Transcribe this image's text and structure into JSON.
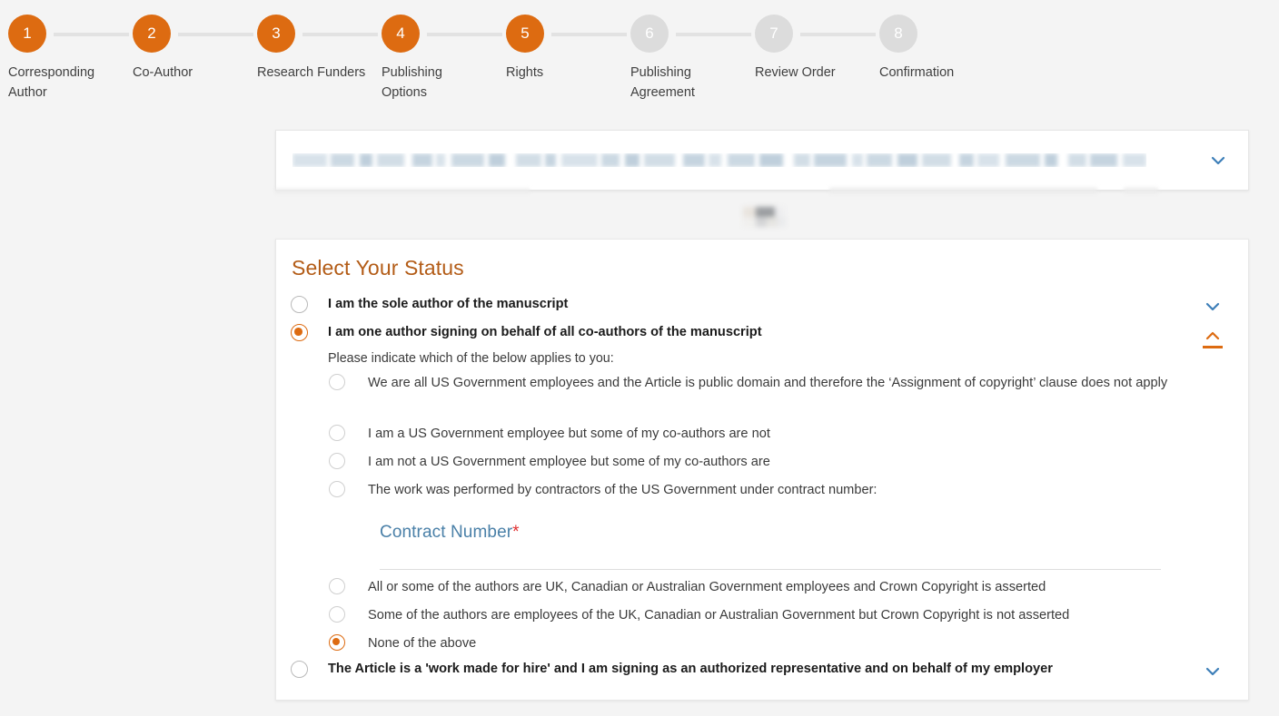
{
  "theme": {
    "accent_orange": "#DD6B11",
    "inactive_gray": "#dcdcdc",
    "link_blue": "#3D7FB8",
    "label_blue": "#4a80a8",
    "required_red": "#e03030",
    "title_orange": "#b35c17",
    "page_bg": "#f4f4f4"
  },
  "stepper": {
    "steps": [
      {
        "number": "1",
        "label": "Corresponding Author",
        "state": "active"
      },
      {
        "number": "2",
        "label": "Co-Author",
        "state": "active"
      },
      {
        "number": "3",
        "label": "Research Funders",
        "state": "active"
      },
      {
        "number": "4",
        "label": "Publishing Options",
        "state": "active"
      },
      {
        "number": "5",
        "label": "Rights",
        "state": "active"
      },
      {
        "number": "6",
        "label": "Publishing Agreement",
        "state": "inactive"
      },
      {
        "number": "7",
        "label": "Review Order",
        "state": "inactive"
      },
      {
        "number": "8",
        "label": "Confirmation",
        "state": "inactive"
      }
    ]
  },
  "redacted_panel": {
    "content": "",
    "expand_icon": "chevron-down-icon"
  },
  "card": {
    "title": "Select Your Status",
    "options": [
      {
        "id": "sole-author",
        "label": "I am the sole author of the manuscript",
        "checked": false,
        "expand_icon": "chevron-down-icon"
      },
      {
        "id": "signing-on-behalf",
        "label": "I am one author signing on behalf of all co-authors of the manuscript",
        "checked": true,
        "expand_icon": "chevron-up-icon"
      },
      {
        "id": "work-made-for-hire",
        "label": "The Article is a 'work made for hire' and I am signing as an authorized representative and on behalf of my employer",
        "checked": false,
        "expand_icon": "chevron-down-icon"
      }
    ],
    "sub_section": {
      "hint": "Please indicate which of the below applies to you:",
      "sub_options": [
        {
          "id": "all-us-gov",
          "label": "We are all US Government employees and the Article is public domain and therefore the ‘Assignment of copyright’ clause does not apply",
          "checked": false
        },
        {
          "id": "us-gov-some-not",
          "label": "I am a US Government employee but some of my co-authors are not",
          "checked": false
        },
        {
          "id": "not-us-gov-some-are",
          "label": "I am not a US Government employee but some of my co-authors are",
          "checked": false
        },
        {
          "id": "contractors-us-gov",
          "label": "The work was performed by contractors of the US Government under contract number:",
          "checked": false
        },
        {
          "id": "crown-asserted",
          "label": "All or some of the authors are UK, Canadian or Australian Government employees and Crown Copyright is asserted",
          "checked": false
        },
        {
          "id": "crown-not-asserted",
          "label": "Some of the authors are employees of the UK, Canadian or Australian Government but Crown Copyright is not asserted",
          "checked": false
        },
        {
          "id": "none-of-the-above",
          "label": "None of the above",
          "checked": true
        }
      ],
      "contract_number_field": {
        "label": "Contract Number",
        "required_marker": "*",
        "value": "",
        "placeholder": ""
      }
    }
  }
}
